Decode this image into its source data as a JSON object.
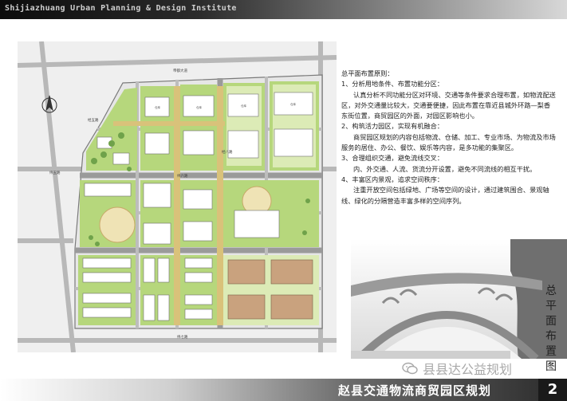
{
  "header": {
    "banner_text": "Shijiazhuang Urban Planning & Design Institute"
  },
  "plan": {
    "road_labels": [
      "帝都大道",
      "经五路",
      "纬五路",
      "纬六路",
      "经八路",
      "纬七路"
    ],
    "block_label": "仓库",
    "colors": {
      "green": "#b6d77c",
      "light_green": "#dcebb6",
      "road": "#8a8a8a",
      "plaza": "#d9c27a",
      "hall": "#c9a27e"
    }
  },
  "description": {
    "heading": "总平面布置原则：",
    "s1_title": "1、分析用地条件、布置功能分区：",
    "s1_body": "认真分析不同功能分区对环境、交通等条件要求合理布置，如物流配送区，对外交通量比较大，交通要便捷，因此布置在靠近县城外环路—梨香东街位置，商贸园区的外面，对园区影响也小。",
    "s2_title": "2、构筑活力园区，实现有机融合：",
    "s2_body": "商贸园区规划的内容包括物流、仓储、加工、专业市场、为物流及市场服务的居住、办公、餐饮、娱乐等内容，是多功能的集聚区。",
    "s3_title": "3、合理组织交通，避免流线交叉：",
    "s3_body": "内、外交通、人流、货流分开设置，避免不同流线的相互干扰。",
    "s4_title": "4、丰富区内景观，追求空间秩序：",
    "s4_body": "注重开放空间包括绿地、广场等空间的设计，通过建筑围合、景观轴线、绿化的分隔营造丰富多样的空间序列。"
  },
  "side_title": [
    "总",
    "平",
    "面",
    "布",
    "置",
    "图"
  ],
  "watermark": {
    "text": "县县达公益规划",
    "icon": "wechat-icon"
  },
  "footer": {
    "title": "赵县交通物流商贸园区规划",
    "page_number": "2"
  }
}
